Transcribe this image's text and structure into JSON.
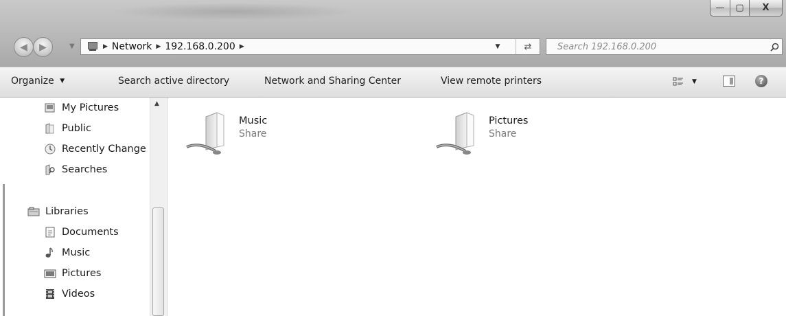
{
  "window": {
    "caption_buttons": {
      "minimize": "—",
      "maximize": "▢",
      "close": "X"
    }
  },
  "navigation": {
    "back_icon": "back-arrow-icon",
    "forward_icon": "forward-arrow-icon"
  },
  "address": {
    "crumbs": [
      "Network",
      "192.168.0.200"
    ],
    "icon": "network-computer-icon"
  },
  "search": {
    "placeholder": "Search 192.168.0.200",
    "icon": "search-icon"
  },
  "toolbar": {
    "organize": "Organize",
    "search_active_directory": "Search active directory",
    "network_and_sharing_center": "Network and Sharing Center",
    "view_remote_printers": "View remote printers",
    "help": "?"
  },
  "sidebar": {
    "items": [
      {
        "label": "My Pictures",
        "icon": "pictures-folder-icon"
      },
      {
        "label": "Public",
        "icon": "folder-icon"
      },
      {
        "label": "Recently Change",
        "icon": "recent-changes-icon"
      },
      {
        "label": "Searches",
        "icon": "searches-folder-icon"
      },
      {
        "label": "Libraries",
        "icon": "libraries-icon"
      },
      {
        "label": "Documents",
        "icon": "document-icon"
      },
      {
        "label": "Music",
        "icon": "music-note-icon"
      },
      {
        "label": "Pictures",
        "icon": "picture-icon"
      },
      {
        "label": "Videos",
        "icon": "film-icon"
      }
    ]
  },
  "content": {
    "shares": [
      {
        "name": "Music",
        "type": "Share",
        "icon": "shared-folder-icon"
      },
      {
        "name": "Pictures",
        "type": "Share",
        "icon": "shared-folder-icon"
      }
    ]
  },
  "colors": {
    "frame": "#bdbdbd",
    "toolbar": "#e9e9e9",
    "secondary_text": "#7a7a7a",
    "search_placeholder": "#8a8a8a"
  }
}
